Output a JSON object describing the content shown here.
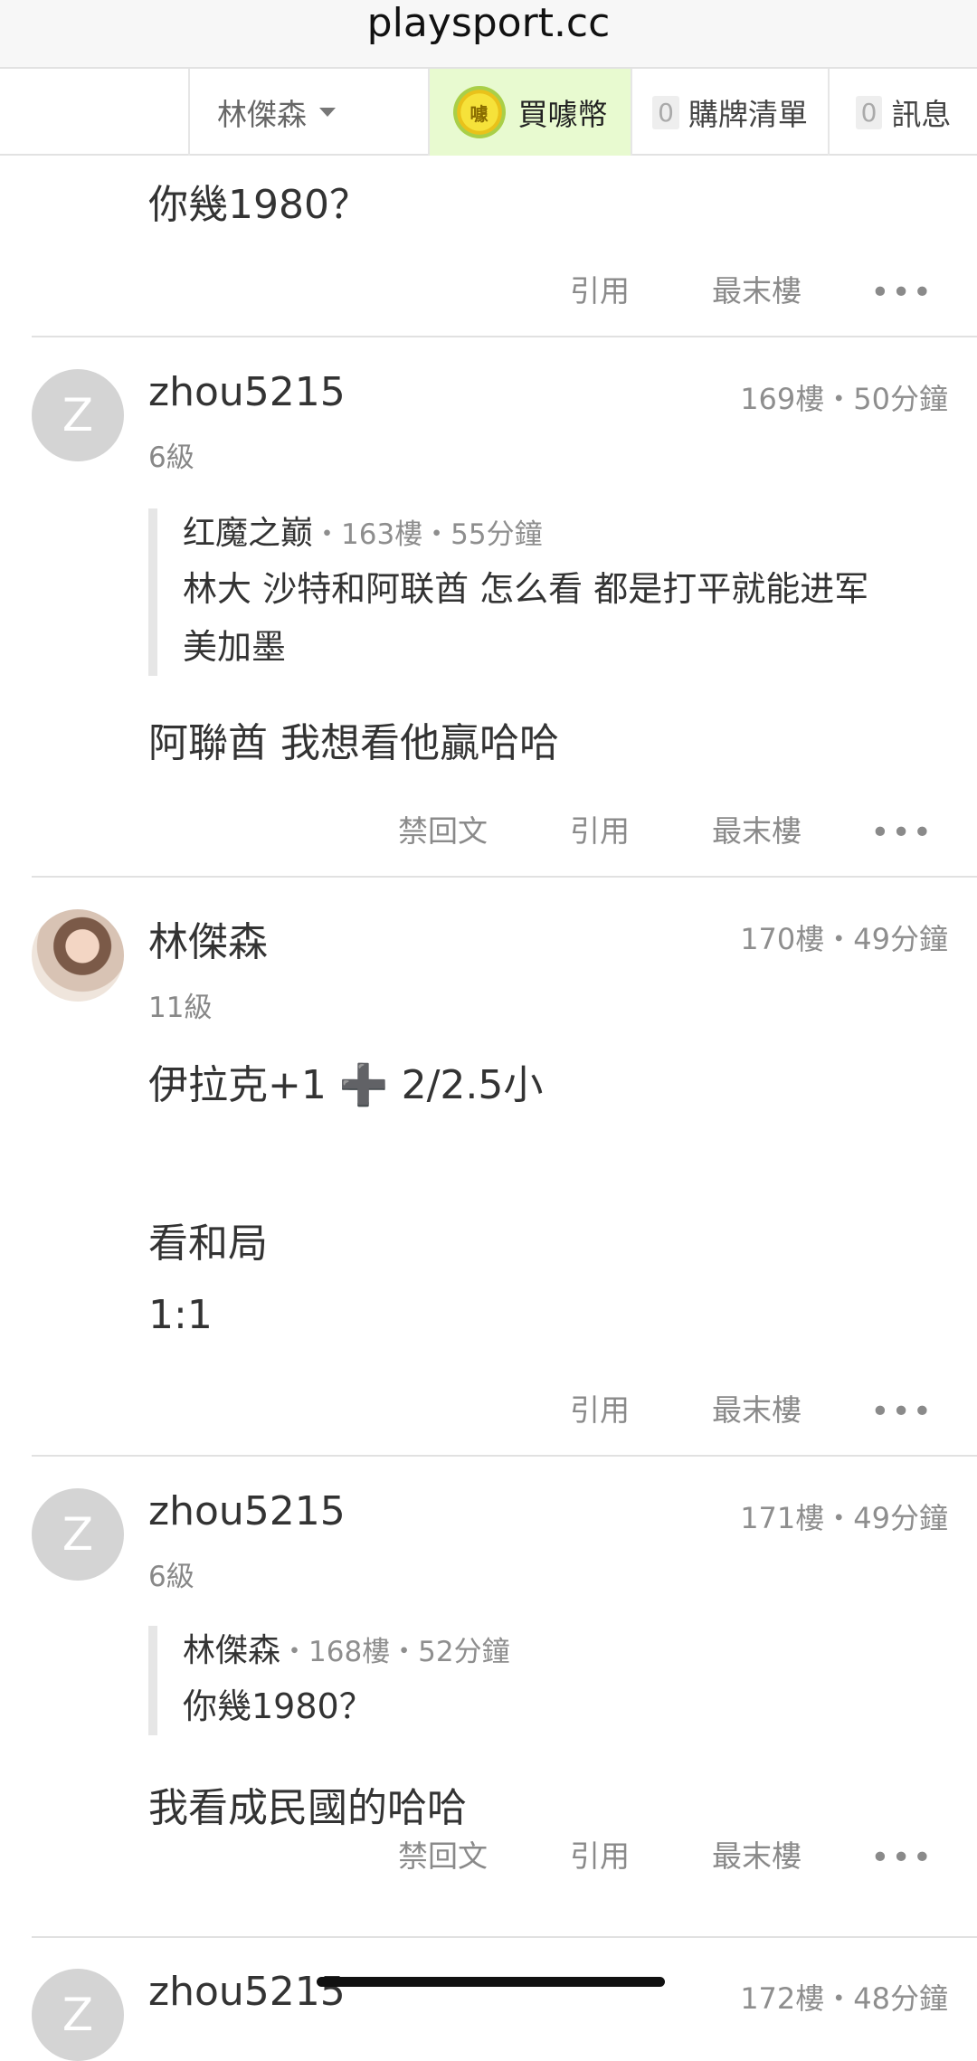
{
  "url": "playsport.cc",
  "nav": {
    "user": "林傑森",
    "coin_icon_text": "噱",
    "coin_label": "買噱幣",
    "list_count": "0",
    "list_label": "購牌清單",
    "msg_count": "0",
    "msg_label": "訊息"
  },
  "top_fragment": {
    "content": "你幾1980？",
    "actions": {
      "quote": "引用",
      "last": "最末樓"
    }
  },
  "posts": [
    {
      "avatar_letter": "Z",
      "username": "zhou5215",
      "level": "6級",
      "meta": "169樓・50分鐘",
      "quote": {
        "author": "红魔之巅",
        "meta": "・163樓・55分鐘",
        "lines": [
          "林大 沙特和阿联酋 怎么看 都是打平就能进军",
          "美加墨"
        ]
      },
      "content": "阿聯酋 我想看他贏哈哈",
      "actions": {
        "ban": "禁回文",
        "quote": "引用",
        "last": "最末樓"
      }
    },
    {
      "username": "林傑森",
      "level": "11級",
      "meta": "170樓・49分鐘",
      "lines": [
        "伊拉克+1 ➕ 2/2.5小",
        "看和局",
        "1:1"
      ],
      "actions": {
        "quote": "引用",
        "last": "最末樓"
      }
    },
    {
      "avatar_letter": "Z",
      "username": "zhou5215",
      "level": "6級",
      "meta": "171樓・49分鐘",
      "quote": {
        "author": "林傑森",
        "meta": "・168樓・52分鐘",
        "lines": [
          "你幾1980？"
        ]
      },
      "content": "我看成民國的哈哈",
      "actions": {
        "ban": "禁回文",
        "quote": "引用",
        "last": "最末樓"
      }
    },
    {
      "avatar_letter": "Z",
      "username": "zhou5215",
      "meta": "172樓・48分鐘"
    }
  ],
  "more_glyph": "•••"
}
